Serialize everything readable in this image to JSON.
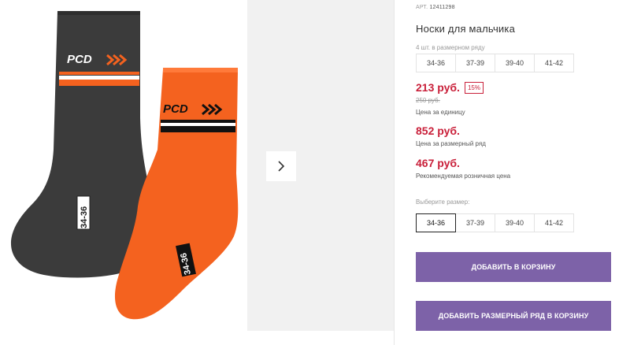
{
  "product": {
    "art_label": "АРТ.",
    "art_value": "12411298",
    "title": "Носки для мальчика",
    "range_note": "4 шт. в размерном ряду",
    "range_sizes": [
      "34-36",
      "37-39",
      "39-40",
      "41-42"
    ],
    "price_unit": "213 руб.",
    "discount": "15%",
    "old_price": "250 руб.",
    "price_unit_caption": "Цена за единицу",
    "price_range": "852 руб.",
    "price_range_caption": "Цена за размерный ряд",
    "price_retail": "467 руб.",
    "price_retail_caption": "Рекомендуемая розничная цена",
    "pick_label": "Выберите размер:",
    "pick_sizes": [
      "34-36",
      "37-39",
      "39-40",
      "41-42"
    ],
    "selected_size": "34-36",
    "add_to_cart": "ДОБАВИТЬ В КОРЗИНУ",
    "add_range_to_cart": "ДОБАВИТЬ РАЗМЕРНЫЙ РЯД В КОРЗИНУ"
  },
  "gallery": {
    "sock_logo": "PCD",
    "sock_size_tag": "34-36",
    "next_icon": "chevron-right-icon"
  },
  "colors": {
    "price_red": "#c9203a",
    "button_purple": "#7d62a8",
    "sock_dark": "#3b3b3b",
    "sock_orange": "#f4621f"
  }
}
